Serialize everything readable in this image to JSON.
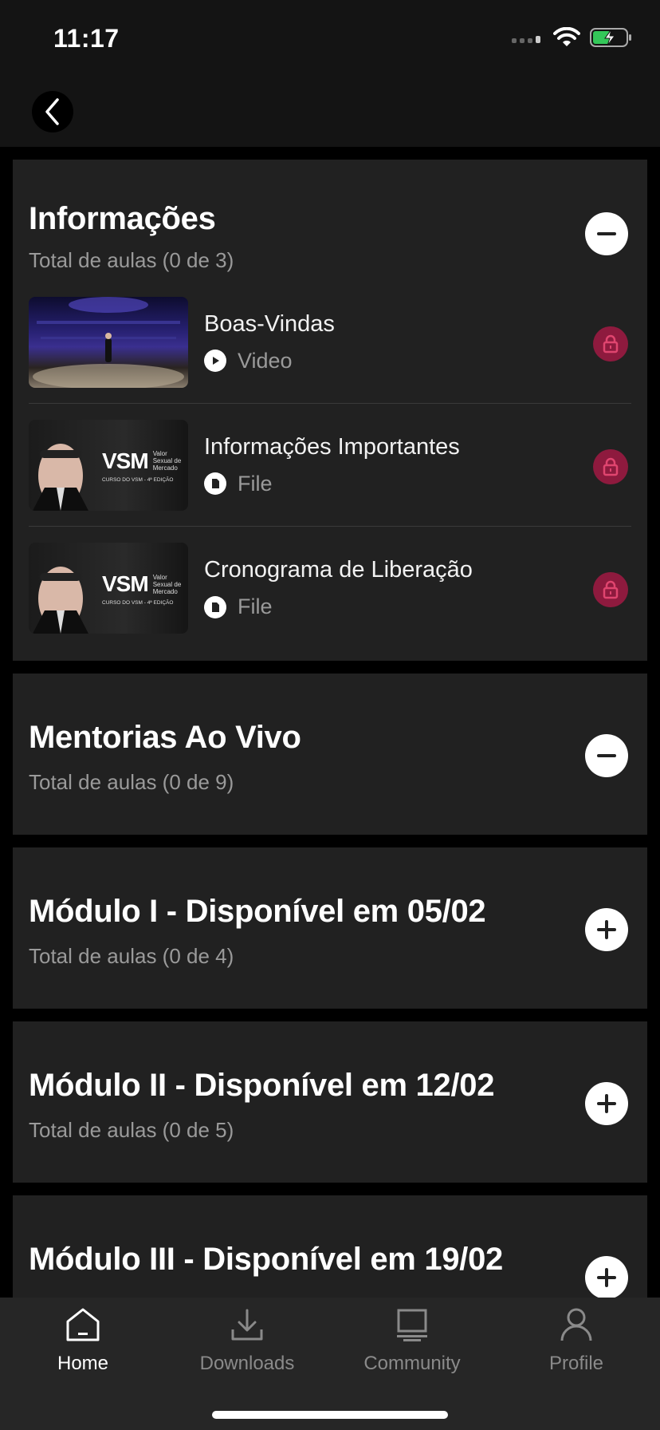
{
  "status": {
    "time": "11:17"
  },
  "sections": [
    {
      "title": "Informações",
      "subtitle": "Total de aulas (0 de 3)",
      "expanded": true,
      "lessons": [
        {
          "title": "Boas-Vindas",
          "type": "Video",
          "type_icon": "play-icon",
          "locked": true
        },
        {
          "title": "Informações Importantes",
          "type": "File",
          "type_icon": "file-icon",
          "locked": true
        },
        {
          "title": "Cronograma de Liberação",
          "type": "File",
          "type_icon": "file-icon",
          "locked": true
        }
      ]
    },
    {
      "title": "Mentorias Ao Vivo",
      "subtitle": "Total de aulas (0 de 9)",
      "expanded": true
    },
    {
      "title": "Módulo I - Disponível em 05/02",
      "subtitle": "Total de aulas (0 de 4)",
      "expanded": false
    },
    {
      "title": "Módulo II - Disponível em 12/02",
      "subtitle": "Total de aulas (0 de 5)",
      "expanded": false
    },
    {
      "title": "Módulo III - Disponível em 19/02",
      "subtitle": "",
      "expanded": false
    }
  ],
  "thumbnails": {
    "vsm_logo": "VSM",
    "vsm_tagline": "Valor Sexual de Mercado",
    "vsm_course": "CURSO DO VSM - 4ª EDIÇÃO"
  },
  "tabs": [
    {
      "label": "Home",
      "icon": "home-icon",
      "active": true
    },
    {
      "label": "Downloads",
      "icon": "download-icon",
      "active": false
    },
    {
      "label": "Community",
      "icon": "community-icon",
      "active": false
    },
    {
      "label": "Profile",
      "icon": "profile-icon",
      "active": false
    }
  ],
  "colors": {
    "background": "#000000",
    "card": "#212121",
    "lock": "#8e1a3e",
    "battery": "#34c759"
  }
}
